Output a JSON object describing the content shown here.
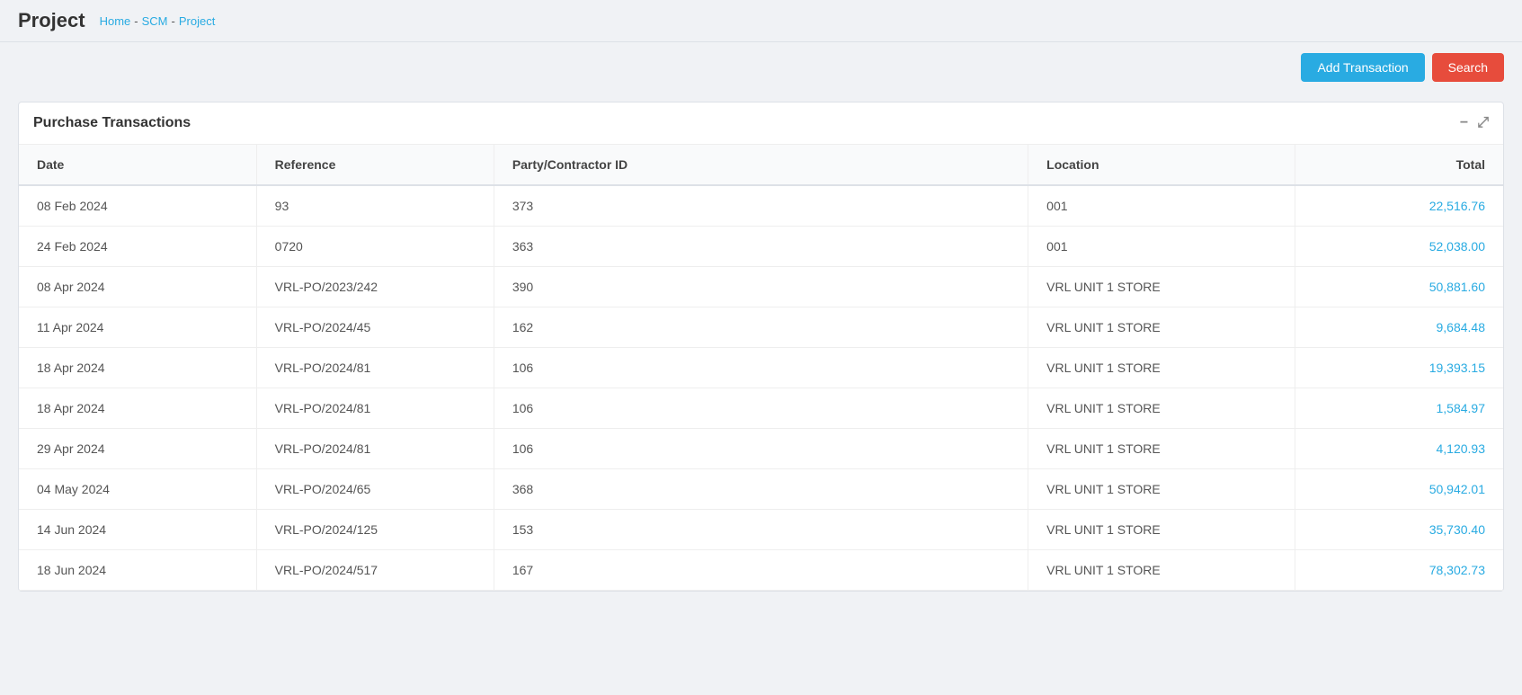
{
  "header": {
    "title": "Project",
    "breadcrumb": [
      {
        "label": "Home",
        "link": true
      },
      {
        "separator": "-"
      },
      {
        "label": "SCM",
        "link": true
      },
      {
        "separator": "-"
      },
      {
        "label": "Project",
        "link": true
      }
    ]
  },
  "toolbar": {
    "add_button": "Add Transaction",
    "search_button": "Search"
  },
  "panel": {
    "title": "Purchase Transactions",
    "minimize_icon": "−",
    "expand_icon": "⤢"
  },
  "table": {
    "columns": [
      {
        "key": "date",
        "label": "Date"
      },
      {
        "key": "reference",
        "label": "Reference"
      },
      {
        "key": "party",
        "label": "Party/Contractor ID"
      },
      {
        "key": "location",
        "label": "Location"
      },
      {
        "key": "total",
        "label": "Total"
      }
    ],
    "rows": [
      {
        "date": "08 Feb 2024",
        "reference": "93",
        "party": "373",
        "location": "001",
        "total": "22,516.76"
      },
      {
        "date": "24 Feb 2024",
        "reference": "0720",
        "party": "363",
        "location": "001",
        "total": "52,038.00"
      },
      {
        "date": "08 Apr 2024",
        "reference": "VRL-PO/2023/242",
        "party": "390",
        "location": "VRL UNIT 1 STORE",
        "total": "50,881.60"
      },
      {
        "date": "11 Apr 2024",
        "reference": "VRL-PO/2024/45",
        "party": "162",
        "location": "VRL UNIT 1 STORE",
        "total": "9,684.48"
      },
      {
        "date": "18 Apr 2024",
        "reference": "VRL-PO/2024/81",
        "party": "106",
        "location": "VRL UNIT 1 STORE",
        "total": "19,393.15"
      },
      {
        "date": "18 Apr 2024",
        "reference": "VRL-PO/2024/81",
        "party": "106",
        "location": "VRL UNIT 1 STORE",
        "total": "1,584.97"
      },
      {
        "date": "29 Apr 2024",
        "reference": "VRL-PO/2024/81",
        "party": "106",
        "location": "VRL UNIT 1 STORE",
        "total": "4,120.93"
      },
      {
        "date": "04 May 2024",
        "reference": "VRL-PO/2024/65",
        "party": "368",
        "location": "VRL UNIT 1 STORE",
        "total": "50,942.01"
      },
      {
        "date": "14 Jun 2024",
        "reference": "VRL-PO/2024/125",
        "party": "153",
        "location": "VRL UNIT 1 STORE",
        "total": "35,730.40"
      },
      {
        "date": "18 Jun 2024",
        "reference": "VRL-PO/2024/517",
        "party": "167",
        "location": "VRL UNIT 1 STORE",
        "total": "78,302.73"
      }
    ]
  },
  "colors": {
    "accent": "#29abe2",
    "danger": "#e74c3c",
    "background": "#f0f2f5",
    "text_link": "#29abe2"
  }
}
